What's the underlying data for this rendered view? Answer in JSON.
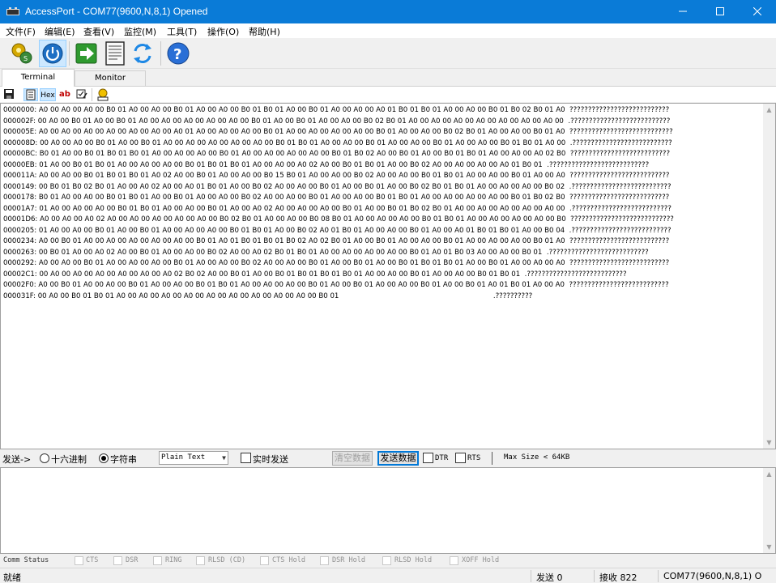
{
  "window": {
    "title": "AccessPort - COM77(9600,N,8,1) Opened",
    "titlebar_color": "#0a7bd7"
  },
  "menu": [
    {
      "label": "文件(F)"
    },
    {
      "label": "编辑(E)"
    },
    {
      "label": "查看(V)"
    },
    {
      "label": "监控(M)"
    },
    {
      "label": "工具(T)"
    },
    {
      "label": "操作(O)"
    },
    {
      "label": "帮助(H)"
    }
  ],
  "toolbar": {
    "buttons": [
      {
        "icon": "gear-connect-icon"
      },
      {
        "icon": "power-icon",
        "pressed": true
      },
      {
        "icon": "green-arrow-icon"
      },
      {
        "icon": "document-icon"
      },
      {
        "icon": "refresh-icon"
      },
      {
        "icon": "help-icon"
      }
    ]
  },
  "tabs": [
    {
      "label": "Terminal",
      "active": true
    },
    {
      "label": "Monitor",
      "active": false
    }
  ],
  "subtoolbar": {
    "hex_label": "Hex",
    "ab_label": "ab"
  },
  "terminal": {
    "lines": [
      {
        "addr": "0000000:",
        "hex": "A0 00 A0 00 A0 00 B0 01 A0 00 A0 00 B0 01 A0 00 A0 00 B0 01 B0 01 A0 00 B0 01 A0 00 A0 00 A0 01 B0 01 B0 01 A0 00 A0 00 B0 01 B0 02 B0 01 A0",
        "ascii": "???????????????????????????"
      },
      {
        "addr": "000002F:",
        "hex": "00 A0 00 B0 01 A0 00 B0 01 A0 00 A0 00 A0 00 A0 00 A0 00 B0 01 A0 00 B0 01 A0 00 A0 00 B0 02 B0 01 A0 00 A0 00 A0 00 A0 00 A0 00 A0 00 A0 00",
        "ascii": ".???????????????????????????"
      },
      {
        "addr": "000005E:",
        "hex": "A0 00 A0 00 A0 00 A0 00 A0 00 A0 00 A0 01 A0 00 A0 00 A0 00 B0 01 A0 00 A0 00 A0 00 A0 00 B0 01 A0 00 A0 00 B0 02 B0 01 A0 00 A0 00 B0 01 A0",
        "ascii": "????????????????????????????"
      },
      {
        "addr": "000008D:",
        "hex": "00 A0 00 A0 00 B0 01 A0 00 B0 01 A0 00 A0 00 A0 00 A0 00 A0 00 B0 01 B0 01 A0 00 A0 00 B0 01 A0 00 A0 00 B0 01 A0 00 A0 00 B0 01 B0 01 A0 00",
        "ascii": ".???????????????????????????"
      },
      {
        "addr": "00000BC:",
        "hex": "B0 01 A0 00 B0 01 B0 01 B0 01 A0 00 A0 00 A0 00 B0 01 A0 00 A0 00 A0 00 A0 00 B0 01 B0 02 A0 00 B0 01 A0 00 B0 01 B0 01 A0 00 A0 00 A0 02 B0",
        "ascii": "???????????????????????????"
      },
      {
        "addr": "00000EB:",
        "hex": "01 A0 00 B0 01 B0 01 A0 00 A0 00 A0 00 B0 01 B0 01 B0 01 A0 00 A0 00 A0 02 A0 00 B0 01 B0 01 A0 00 B0 02 A0 00 A0 00 A0 00 A0 01 B0 01",
        "ascii": ".???????????????????????????"
      },
      {
        "addr": "000011A:",
        "hex": "A0 00 A0 00 B0 01 B0 01 B0 01 A0 02 A0 00 B0 01 A0 00 A0 00 B0 15 B0 01 A0 00 A0 00 B0 02 A0 00 A0 00 B0 01 B0 01 A0 00 A0 00 B0 01 A0 00 A0",
        "ascii": "???????????????????????????"
      },
      {
        "addr": "0000149:",
        "hex": "00 B0 01 B0 02 B0 01 A0 00 A0 02 A0 00 A0 01 B0 01 A0 00 B0 02 A0 00 A0 00 B0 01 A0 00 B0 01 A0 00 B0 02 B0 01 B0 01 A0 00 A0 00 A0 00 B0 02",
        "ascii": ".???????????????????????????"
      },
      {
        "addr": "0000178:",
        "hex": "B0 01 A0 00 A0 00 B0 01 B0 01 A0 00 B0 01 A0 00 A0 00 B0 02 A0 00 A0 00 B0 01 A0 00 A0 00 B0 01 B0 01 A0 00 A0 00 A0 00 A0 00 B0 01 B0 02 B0",
        "ascii": "???????????????????????????"
      },
      {
        "addr": "00001A7:",
        "hex": "01 A0 00 A0 00 A0 00 B0 01 B0 01 A0 00 A0 00 B0 01 A0 00 A0 02 A0 00 A0 00 A0 00 B0 01 A0 00 B0 01 B0 02 B0 01 A0 00 A0 00 A0 00 A0 00 A0 00",
        "ascii": ".???????????????????????????"
      },
      {
        "addr": "00001D6:",
        "hex": "A0 00 A0 00 A0 02 A0 00 A0 00 A0 00 A0 00 A0 00 B0 02 B0 01 A0 00 A0 00 B0 08 B0 01 A0 00 A0 00 A0 00 B0 01 B0 01 A0 00 A0 00 A0 00 A0 00 B0",
        "ascii": "????????????????????????????"
      },
      {
        "addr": "0000205:",
        "hex": "01 A0 00 A0 00 B0 01 A0 00 B0 01 A0 00 A0 00 A0 00 B0 01 B0 01 A0 00 B0 02 A0 01 B0 01 A0 00 A0 00 B0 01 A0 00 A0 01 B0 01 B0 01 A0 00 B0 04",
        "ascii": ".???????????????????????????"
      },
      {
        "addr": "0000234:",
        "hex": "A0 00 B0 01 A0 00 A0 00 A0 00 A0 00 A0 00 B0 01 A0 01 B0 01 B0 01 B0 02 A0 02 B0 01 A0 00 B0 01 A0 00 A0 00 B0 01 A0 00 A0 00 A0 00 B0 01 A0",
        "ascii": "???????????????????????????"
      },
      {
        "addr": "0000263:",
        "hex": "00 B0 01 A0 00 A0 02 A0 00 B0 01 A0 00 A0 00 B0 02 A0 00 A0 02 B0 01 B0 01 A0 00 A0 00 A0 00 A0 00 B0 01 A0 01 B0 03 A0 00 A0 00 B0 01",
        "ascii": ".???????????????????????????"
      },
      {
        "addr": "0000292:",
        "hex": "A0 00 A0 00 B0 01 A0 00 A0 00 A0 00 B0 01 A0 00 A0 00 B0 02 A0 00 A0 00 B0 01 A0 00 B0 01 A0 00 B0 01 B0 01 B0 01 A0 00 B0 01 A0 00 A0 00 A0",
        "ascii": "???????????????????????????"
      },
      {
        "addr": "00002C1:",
        "hex": "00 A0 00 A0 00 A0 00 A0 00 A0 00 A0 02 B0 02 A0 00 B0 01 A0 00 B0 01 B0 01 B0 01 B0 01 A0 00 A0 00 B0 01 A0 00 A0 00 B0 01 B0 01",
        "ascii": ".???????????????????????????"
      },
      {
        "addr": "00002F0:",
        "hex": "A0 00 B0 01 A0 00 A0 00 B0 01 A0 00 A0 00 B0 01 B0 01 A0 00 A0 00 A0 00 B0 01 A0 00 B0 01 A0 00 A0 00 B0 01 A0 00 B0 01 A0 01 B0 01 A0 00 A0",
        "ascii": "???????????????????????????"
      },
      {
        "addr": "000031F:",
        "hex": "00 A0 00 B0 01 B0 01 A0 00 A0 00 A0 00 A0 00 A0 00 A0 00 A0 00 A0 00 A0 00 B0 01",
        "ascii": ".??????????"
      }
    ]
  },
  "sendbar": {
    "label": "发送->",
    "radio_hex": "十六进制",
    "radio_string": "字符串",
    "format_select": "Plain Text",
    "realtime_label": "实时发送",
    "clear_button": "清空数据",
    "send_button": "发送数据",
    "dtr_label": "DTR",
    "rts_label": "RTS",
    "max_size": "Max Size < 64KB"
  },
  "comm_status": {
    "label": "Comm Status",
    "items": [
      "CTS",
      "DSR",
      "RING",
      "RLSD (CD)",
      "CTS Hold",
      "DSR Hold",
      "RLSD Hold",
      "XOFF Hold"
    ]
  },
  "statusbar": {
    "ready": "就绪",
    "sent": "发送 0",
    "received": "接收 822",
    "port": "COM77(9600,N,8,1) O"
  }
}
